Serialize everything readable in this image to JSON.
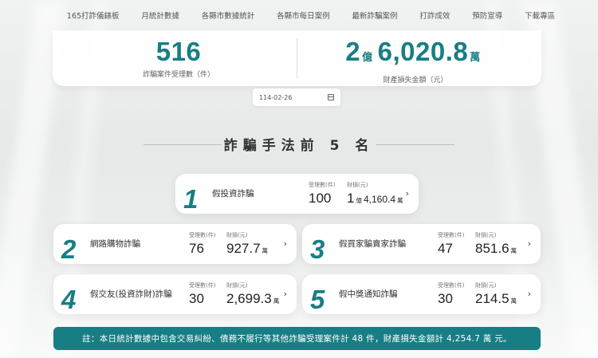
{
  "nav": [
    "165打詐儀錶板",
    "月統計數據",
    "各縣市數據統計",
    "各縣市每日案例",
    "最新詐騙案例",
    "打詐成效",
    "預防宣導",
    "下載專區"
  ],
  "stats": {
    "cases": {
      "value": "516",
      "label": "詐騙案件受理數（件）"
    },
    "loss": {
      "yi": "2",
      "yi_unit": "億",
      "wan": "6,020.8",
      "wan_unit": "萬",
      "label": "財產損失金額（元）"
    }
  },
  "date": {
    "value": "114-02-26"
  },
  "heading": "詐騙手法前 5 名",
  "labels": {
    "cases": "受理數(件)",
    "loss": "財損(元)"
  },
  "rankings": [
    {
      "rank": "1",
      "name": "假投資詐騙",
      "cases": "100",
      "loss_yi": "1",
      "loss_yi_unit": "億",
      "loss_wan": "4,160.4",
      "loss_unit": "萬"
    },
    {
      "rank": "2",
      "name": "網路購物詐騙",
      "cases": "76",
      "loss_wan": "927.7",
      "loss_unit": "萬"
    },
    {
      "rank": "3",
      "name": "假買家騙賣家詐騙",
      "cases": "47",
      "loss_wan": "851.6",
      "loss_unit": "萬"
    },
    {
      "rank": "4",
      "name": "假交友(投資詐財)詐騙",
      "cases": "30",
      "loss_wan": "2,699.3",
      "loss_unit": "萬"
    },
    {
      "rank": "5",
      "name": "假中獎通知詐騙",
      "cases": "30",
      "loss_wan": "214.5",
      "loss_unit": "萬"
    }
  ],
  "note": "註：本日統計數據中包含交易糾紛、債務不履行等其他詐騙受理案件計 48 件，財產損失金額計 4,254.7 萬 元。",
  "colors": {
    "accent": "#177e84"
  }
}
